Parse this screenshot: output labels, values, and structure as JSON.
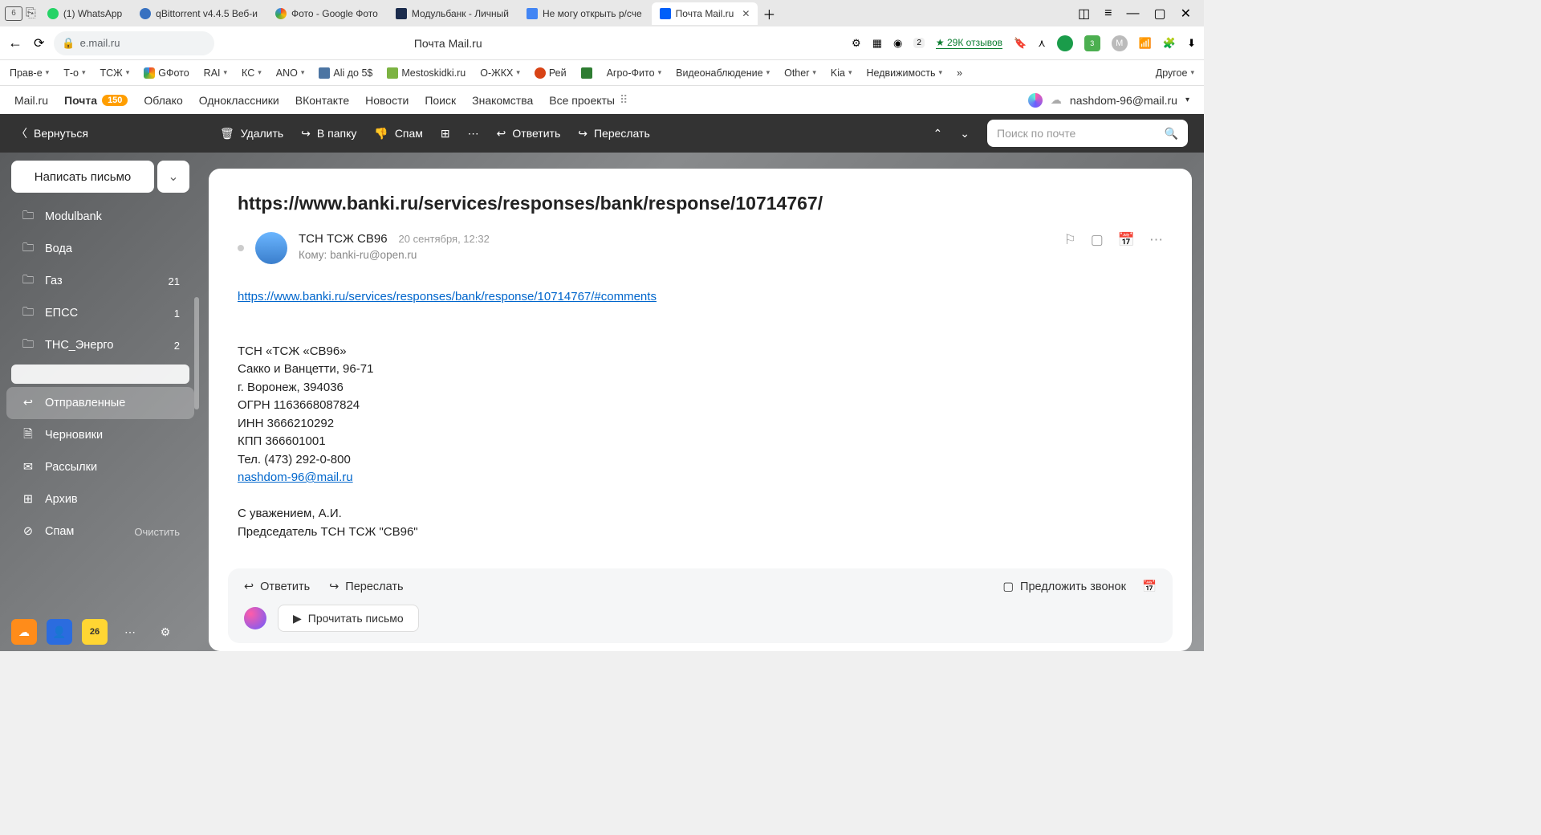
{
  "browser": {
    "tab_counter": "6",
    "tabs": [
      {
        "label": "(1) WhatsApp",
        "fav": "#25d366"
      },
      {
        "label": "qBittorrent v4.4.5 Веб-и",
        "fav": "#3871c1"
      },
      {
        "label": "Фото - Google Фото",
        "fav": "#ea4335"
      },
      {
        "label": "Модульбанк - Личный",
        "fav": "#1a2b4c"
      },
      {
        "label": "Не могу открыть р/сче",
        "fav": "#4285f4"
      },
      {
        "label": "Почта Mail.ru",
        "fav": "#005ff9",
        "active": true
      }
    ],
    "url": "e.mail.ru",
    "page_title": "Почта Mail.ru",
    "reviews": "29К отзывов",
    "bookmarks": [
      {
        "label": "Прав-е",
        "chev": true
      },
      {
        "label": "Т-о",
        "chev": true
      },
      {
        "label": "ТСЖ",
        "chev": true
      },
      {
        "label": "GФото",
        "icon": true
      },
      {
        "label": "RAI",
        "chev": true
      },
      {
        "label": "КС",
        "chev": true
      },
      {
        "label": "ANO",
        "chev": true
      },
      {
        "label": "Ali до 5$",
        "icon": true
      },
      {
        "label": "Mestoskidki.ru",
        "icon": true
      },
      {
        "label": "О-ЖКХ",
        "chev": true
      },
      {
        "label": "Рей",
        "icon": true
      },
      {
        "label": "",
        "icon": true
      },
      {
        "label": "Агро-Фито",
        "chev": true
      },
      {
        "label": "Видеонаблюдение",
        "chev": true
      },
      {
        "label": "Other",
        "chev": true
      },
      {
        "label": "Kia",
        "chev": true
      },
      {
        "label": "Недвижимость",
        "chev": true
      }
    ],
    "bookmarks_more": "»",
    "bookmarks_other": "Другое"
  },
  "mailru_nav": {
    "items": [
      "Mail.ru",
      "Почта",
      "Облако",
      "Одноклассники",
      "ВКонтакте",
      "Новости",
      "Поиск",
      "Знакомства",
      "Все проекты"
    ],
    "badge": "150",
    "email": "nashdom-96@mail.ru"
  },
  "toolbar": {
    "back": "Вернуться",
    "delete": "Удалить",
    "move": "В папку",
    "spam": "Спам",
    "reply": "Ответить",
    "forward": "Переслать",
    "search_placeholder": "Поиск по почте"
  },
  "sidebar": {
    "compose": "Написать письмо",
    "folders": [
      {
        "label": "Modulbank",
        "count": ""
      },
      {
        "label": "Вода",
        "count": ""
      },
      {
        "label": "Газ",
        "count": "21"
      },
      {
        "label": "ЕПСС",
        "count": "1"
      },
      {
        "label": "ТНС_Энерго",
        "count": "2"
      },
      {
        "label": "",
        "count": "",
        "blank": true
      },
      {
        "label": "Отправленные",
        "count": "",
        "selected": true,
        "icon": "sent"
      },
      {
        "label": "Черновики",
        "count": "",
        "icon": "draft"
      },
      {
        "label": "Рассылки",
        "count": "",
        "icon": "news"
      },
      {
        "label": "Архив",
        "count": "",
        "icon": "archive"
      },
      {
        "label": "Спам",
        "count": "",
        "icon": "spam",
        "action": "Очистить"
      }
    ],
    "calendar_day": "26"
  },
  "mail": {
    "subject": "https://www.banki.ru/services/responses/bank/response/10714767/",
    "sender": "ТСН ТСЖ СВ96",
    "date": "20 сентября, 12:32",
    "to_label": "Кому:",
    "to": "banki-ru@open.ru",
    "body_link": "https://www.banki.ru/services/responses/bank/response/10714767/#comments",
    "sig_lines": [
      "ТСН «ТСЖ «СВ96»",
      "Сакко и Ванцетти, 96-71",
      "г. Воронеж, 394036",
      "ОГРН 1163668087824",
      "ИНН 3666210292",
      "КПП 366601001",
      "Тел. (473) 292-0-800"
    ],
    "sig_email": "nashdom-96@mail.ru",
    "sig_closing1": "С уважением, А.И.",
    "sig_closing2": "Председатель ТСН ТСЖ \"СВ96\""
  },
  "reply_bar": {
    "reply": "Ответить",
    "forward": "Переслать",
    "suggest_call": "Предложить звонок",
    "read": "Прочитать письмо"
  }
}
